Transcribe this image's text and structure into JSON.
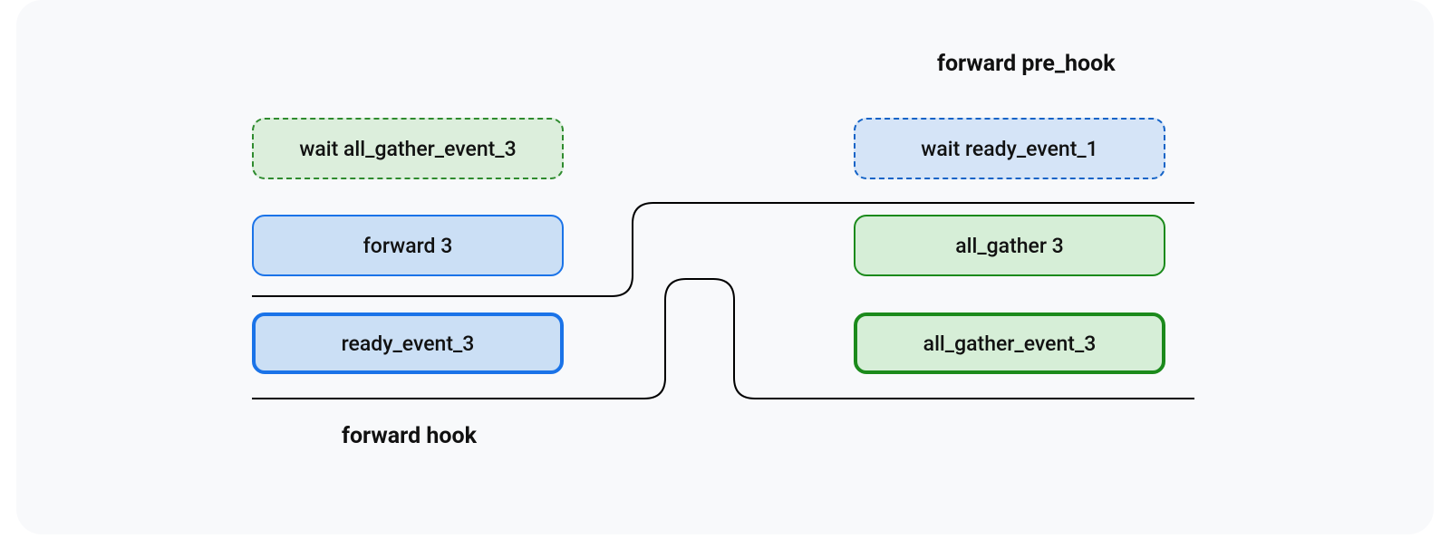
{
  "left": {
    "wait": "wait all_gather_event_3",
    "op1": "forward 3",
    "event": "ready_event_3",
    "hook": "forward hook"
  },
  "right": {
    "prehook": "forward pre_hook",
    "wait": "wait ready_event_1",
    "op1": "all_gather 3",
    "event": "all_gather_event_3"
  },
  "colors": {
    "green_border": "#1b8a1b",
    "green_fill": "#d6eed7",
    "blue_border": "#1a73e8",
    "blue_fill": "#cbdff5"
  }
}
